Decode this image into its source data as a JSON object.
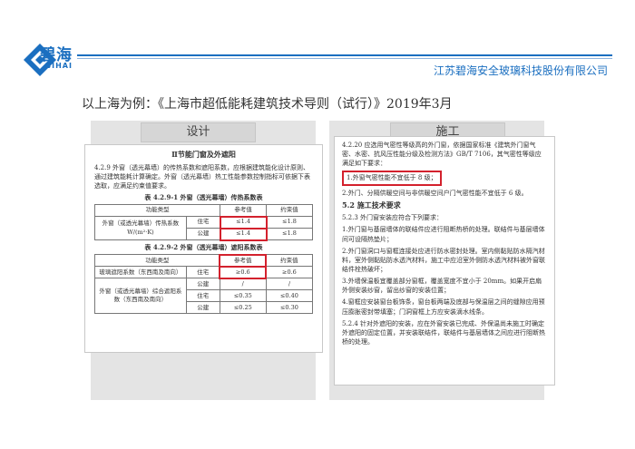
{
  "header": {
    "logo_cn": "碧海",
    "logo_en": "BIHAI",
    "company": "江苏碧海安全玻璃科技股份有限公司",
    "title": "以上海为例：《上海市超低能耗建筑技术导则（试行）》2019年3月"
  },
  "colors": {
    "brand": "#1b6fc0",
    "highlight": "#d3212d",
    "panel": "#e4e4e4"
  },
  "tabs": {
    "design": "设计",
    "construction": "施工"
  },
  "left_doc": {
    "section": "Ⅱ节能门窗及外遮阳",
    "para": "4.2.9 外窗（透光幕墙）的传热系数和遮阳系数，应根据建筑能化设计原则、通过建筑能耗计算确定。外窗（透光幕墙）热工性能参数控制指标可依据下表选取，应满足约束值要求。",
    "table1": {
      "caption": "表 4.2.9-1 外窗（透光幕墙）传热系数表",
      "headers": [
        "功能类型",
        "参考值",
        "约束值"
      ],
      "row_label_1": "外窗（或透光幕墙）传热系数",
      "row_label_2": "W/(m²·K)",
      "rows": [
        {
          "type": "住宅",
          "ref": "≤1.4",
          "limit": "≤1.8"
        },
        {
          "type": "公建",
          "ref": "≤1.4",
          "limit": "≤1.8"
        }
      ]
    },
    "table2": {
      "caption": "表 4.2.9-2 外窗（透光幕墙）遮阳系数表",
      "headers": [
        "功能类型",
        "参考值",
        "约束值"
      ],
      "row1_label": "玻璃遮阳系数（东西南及南向）",
      "row1_type": "住宅",
      "row1_ref": "≥0.6",
      "row1_limit": "≥0.6",
      "row2_label_1": "外窗（或透光幕墙）综合遮阳系",
      "row2_label_2": "数（东西南及南向）",
      "rows2": [
        {
          "type": "公建",
          "ref": "/",
          "limit": "/"
        },
        {
          "type": "住宅",
          "ref": "≤0.35",
          "limit": "≤0.40"
        },
        {
          "type": "公建",
          "ref": "≤0.25",
          "limit": "≤0.30"
        }
      ]
    }
  },
  "right_doc": {
    "p1": "4.2.20 应选用气密性等级高的外门窗，依据国家标准《建筑外门窗气密、水密、抗风压性能分级及检测方法》GB/T 7106，其气密性等级应满足如下要求：",
    "p1_highlight": "1.外窗气密性能不宜低于 8 级；",
    "p2": "2.外门、分隔供暖空间与非供暖空间户门气密性能不宜低于 6 级。",
    "section": "5.2 施工技术要求",
    "p3": "5.2.3 外门窗安装应符合下列要求：",
    "items": [
      "1.外门窗与基层墙体的联结件应进行阻断热桥的处理。联结件与基层墙体间可设隔热垫片；",
      "2.外门窗洞口与窗框连接处应进行防水密封处理。室内侧黏贴防水隔汽材料，室外侧黏贴防水透汽材料，施工中应沿室外侧防水透汽材料被外窗联结件栓热破坏；",
      "3.外墙保温板宜覆盖部分窗框，覆盖宽度不宜小于 20mm。如果开启扇外侧安装纱窗，留出纱窗的安装位置；",
      "4.窗框应安装窗台板饰条，窗台板两端及底部与保温层之间的缝隙应用预压膨胀密封带填塞；门洞窗框上方应安装滴水线条。"
    ],
    "p4": "5.2.4 针对外遮阳的安装，应在外窗安装已完成、外保温尚未施工时确定外遮阳的固定位置，并安装联结件，联结件与基层墙体之间应进行阻断热桥的处理。"
  }
}
